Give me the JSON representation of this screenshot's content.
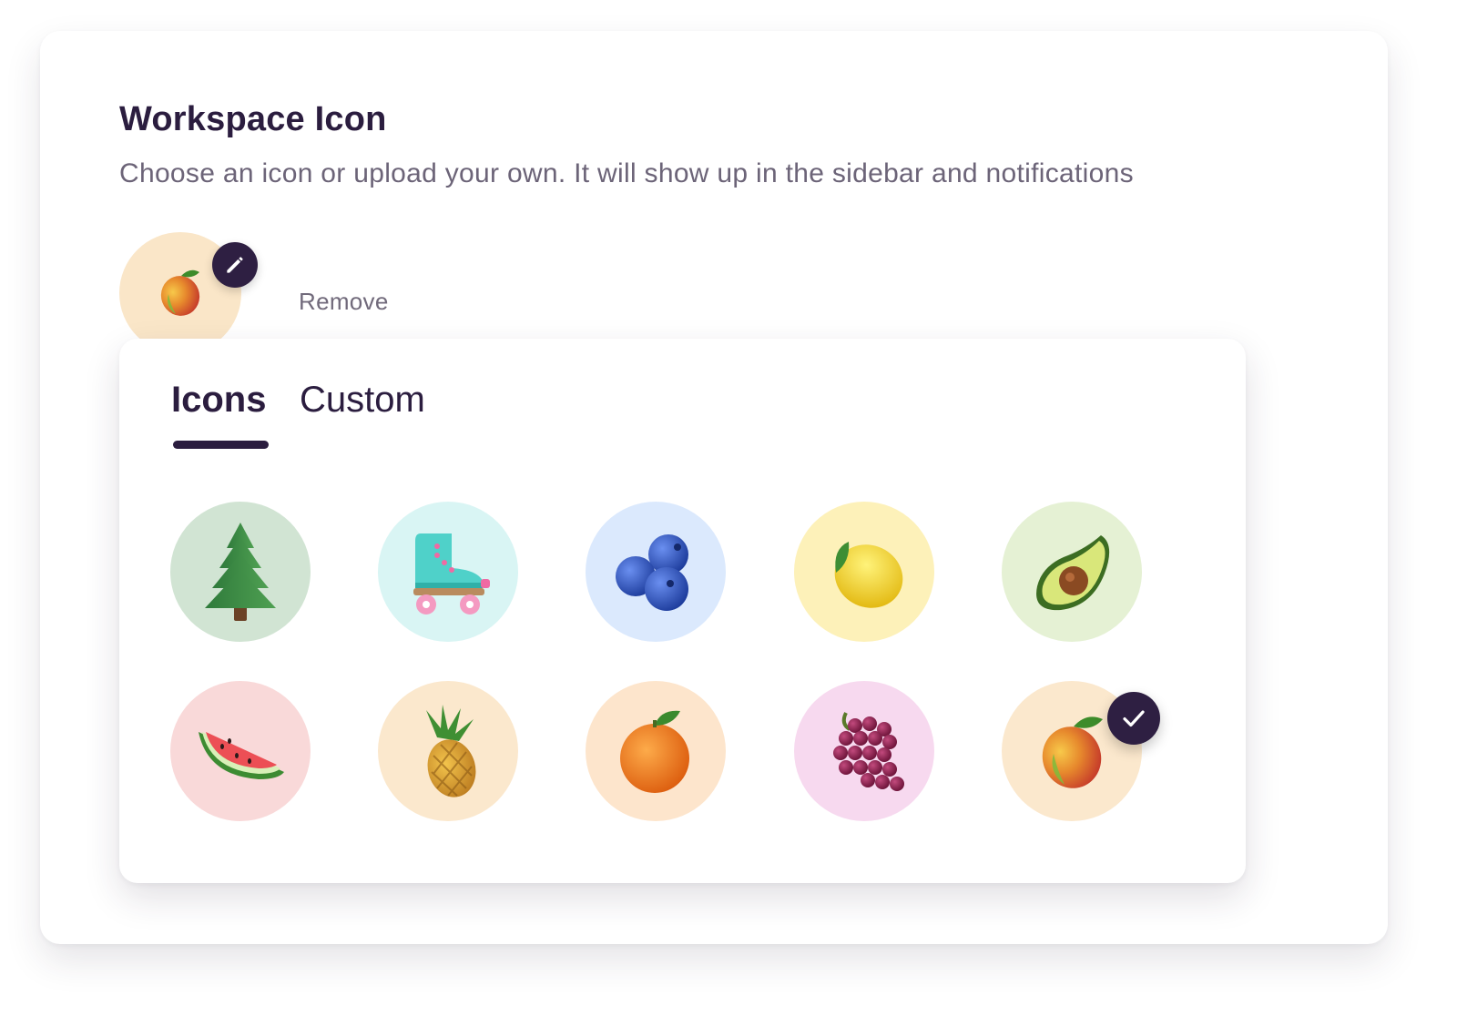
{
  "header": {
    "title": "Workspace Icon",
    "subtitle": "Choose an icon or upload your own. It will show up in the sidebar and notifications"
  },
  "current_icon": {
    "name": "mango-icon",
    "background": "#fae6c8"
  },
  "actions": {
    "remove_label": "Remove"
  },
  "tabs": [
    {
      "label": "Icons",
      "active": true
    },
    {
      "label": "Custom",
      "active": false
    }
  ],
  "icon_options": [
    {
      "name": "pine-tree-icon",
      "background": "#d1e4d3",
      "selected": false
    },
    {
      "name": "roller-skate-icon",
      "background": "#d9f5f4",
      "selected": false
    },
    {
      "name": "blueberries-icon",
      "background": "#dbe9fd",
      "selected": false
    },
    {
      "name": "lemon-icon",
      "background": "#fdf1b9",
      "selected": false
    },
    {
      "name": "avocado-icon",
      "background": "#e5f1d4",
      "selected": false
    },
    {
      "name": "watermelon-icon",
      "background": "#f9d9d9",
      "selected": false
    },
    {
      "name": "pineapple-icon",
      "background": "#fbe8cd",
      "selected": false
    },
    {
      "name": "orange-icon",
      "background": "#fde5cc",
      "selected": false
    },
    {
      "name": "grapes-icon",
      "background": "#f7d9ef",
      "selected": false
    },
    {
      "name": "mango-icon",
      "background": "#fbe8cd",
      "selected": true
    }
  ],
  "colors": {
    "primary": "#2e1f42",
    "text_muted": "#6c6478"
  }
}
